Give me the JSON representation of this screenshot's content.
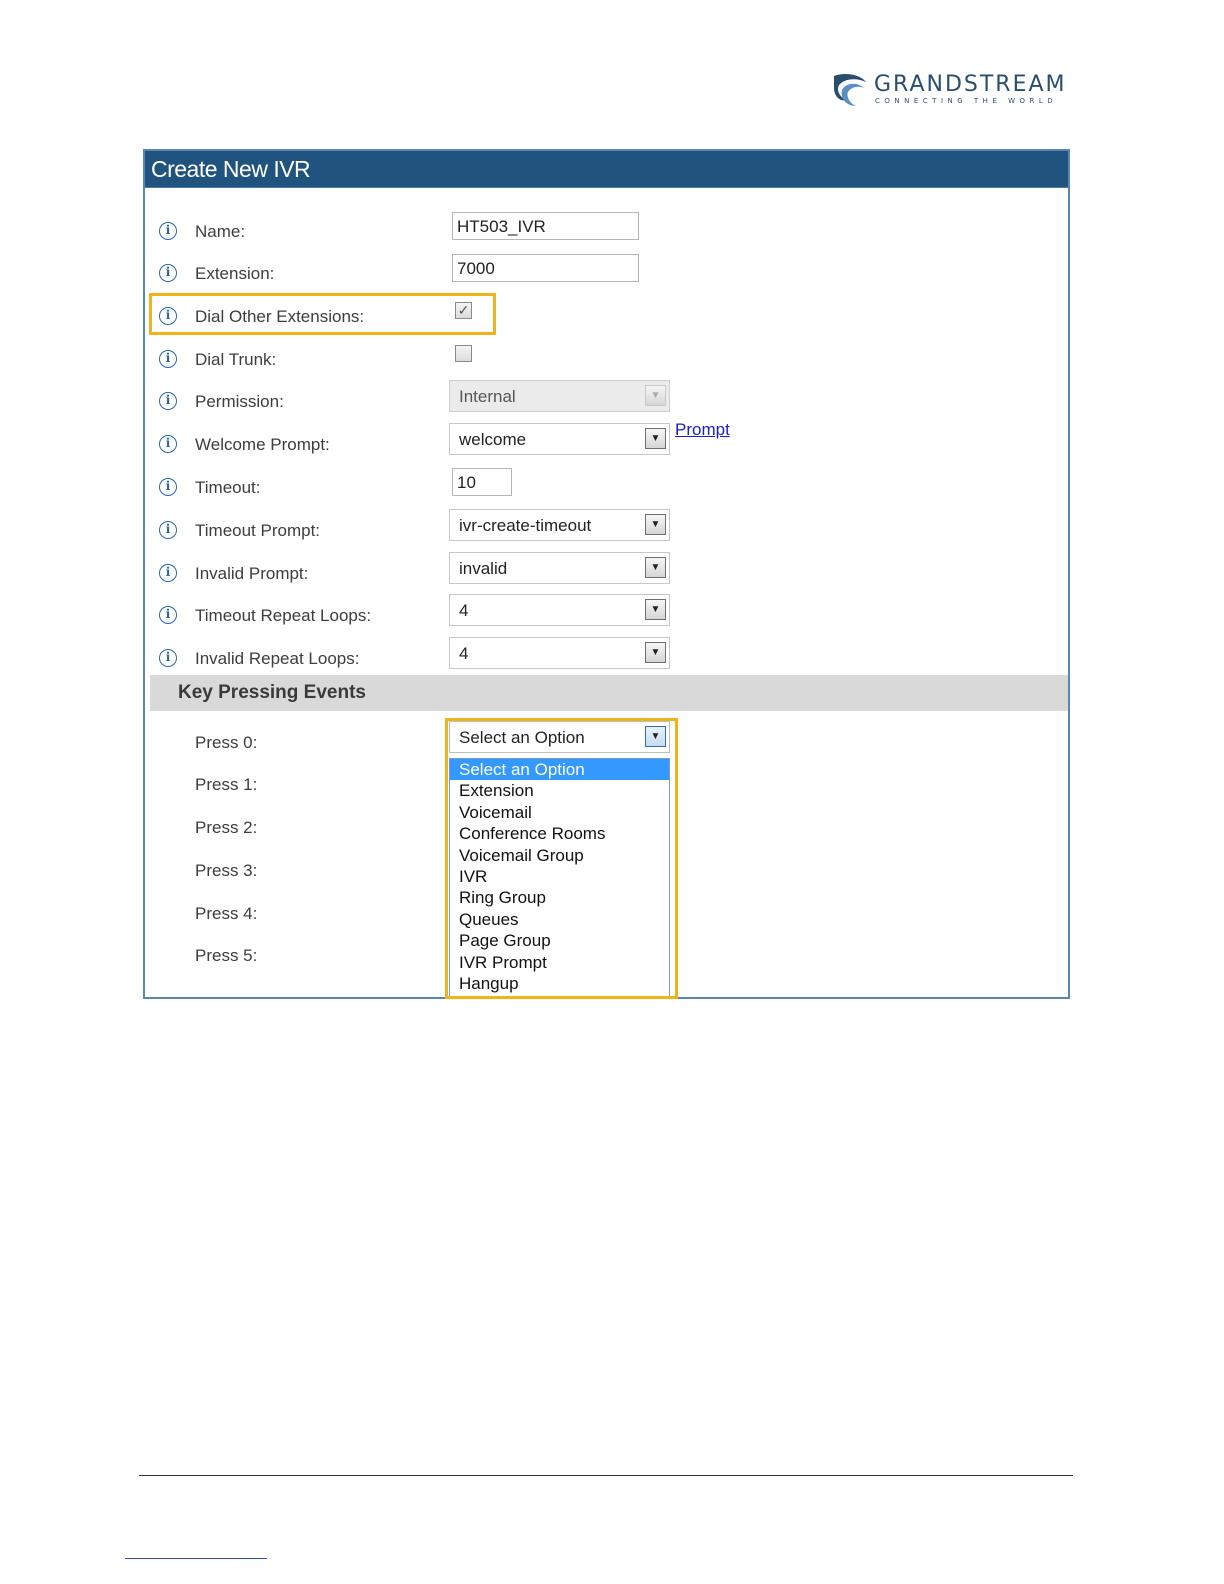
{
  "logo": {
    "wordmark": "GRANDSTREAM",
    "tagline": "CONNECTING THE WORLD",
    "colors": {
      "primary": "#2a4f6e",
      "accent": "#5a8fc4"
    }
  },
  "dialog": {
    "title": "Create New IVR",
    "header_color": "#20537e",
    "fields": {
      "name": {
        "label": "Name:",
        "value": "HT503_IVR"
      },
      "extension": {
        "label": "Extension:",
        "value": "7000"
      },
      "dial_other_extensions": {
        "label": "Dial Other Extensions:",
        "checked": true,
        "mark": "✓"
      },
      "dial_trunk": {
        "label": "Dial Trunk:",
        "checked": false
      },
      "permission": {
        "label": "Permission:",
        "value": "Internal",
        "disabled": true
      },
      "welcome_prompt": {
        "label": "Welcome Prompt:",
        "value": "welcome",
        "link": "Prompt"
      },
      "timeout": {
        "label": "Timeout:",
        "value": "10"
      },
      "timeout_prompt": {
        "label": "Timeout Prompt:",
        "value": "ivr-create-timeout"
      },
      "invalid_prompt": {
        "label": "Invalid Prompt:",
        "value": "invalid"
      },
      "timeout_repeat_loops": {
        "label": "Timeout Repeat Loops:",
        "value": "4"
      },
      "invalid_repeat_loops": {
        "label": "Invalid Repeat Loops:",
        "value": "4"
      }
    },
    "key_pressing": {
      "section_title": "Key Pressing Events",
      "press_labels": [
        "Press 0:",
        "Press 1:",
        "Press 2:",
        "Press 3:",
        "Press 4:",
        "Press 5:"
      ],
      "press0_value": "Select an Option",
      "options": [
        "Select an Option",
        "Extension",
        "Voicemail",
        "Conference Rooms",
        "Voicemail Group",
        "IVR",
        "Ring Group",
        "Queues",
        "Page Group",
        "IVR Prompt",
        "Hangup"
      ],
      "selected_option_index": 0
    },
    "info_icon_glyph": "i",
    "arrow_glyph": "▼"
  },
  "highlight_color": "#f0b418"
}
